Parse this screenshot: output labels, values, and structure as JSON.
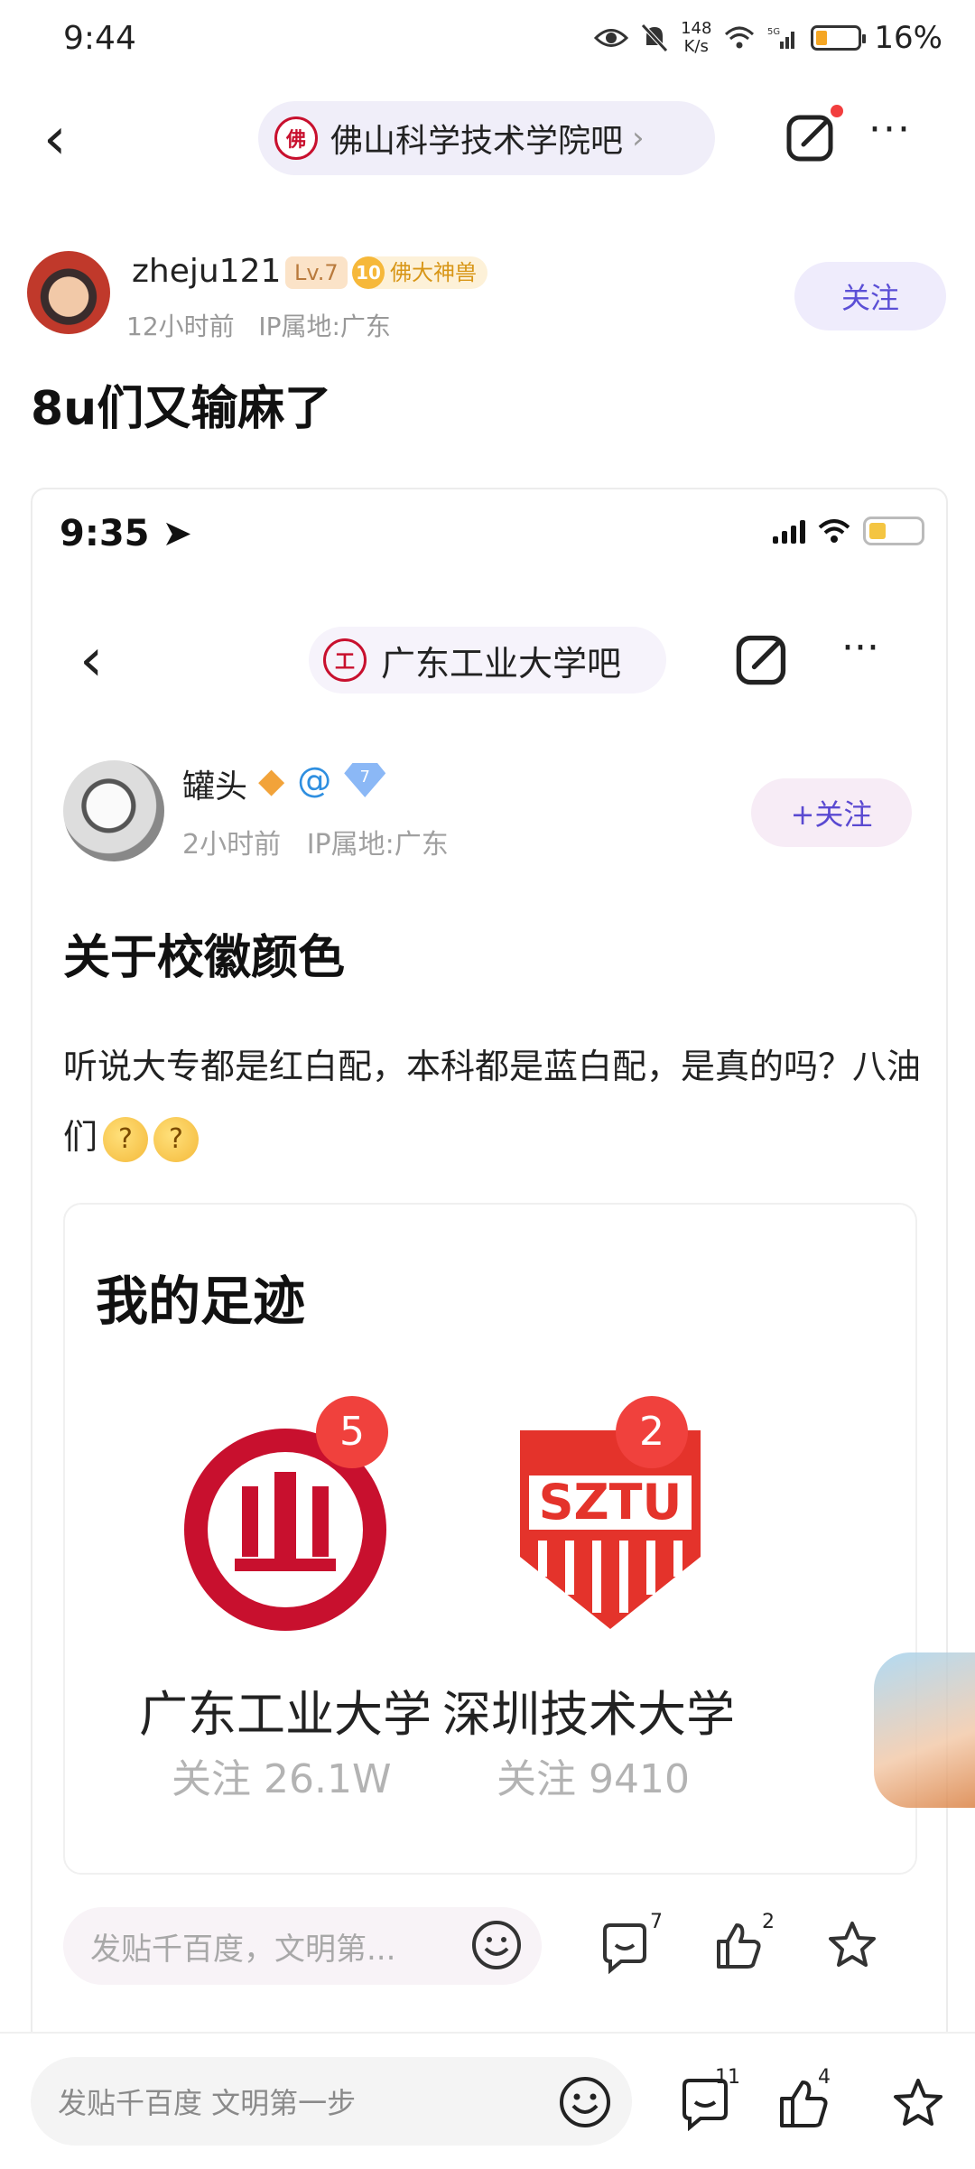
{
  "status": {
    "time": "9:44",
    "speed_top": "148",
    "speed_bottom": "K/s",
    "battery": "16%",
    "network": "5G"
  },
  "nav": {
    "forum_name": "佛山科学技术学院吧",
    "forum_logo_text": "佛"
  },
  "post": {
    "author": "zheju121",
    "level": "Lv.7",
    "title_badge_num": "10",
    "title_badge": "佛大神兽",
    "time": "12小时前",
    "ip": "IP属地:广东",
    "follow": "关注",
    "title": "8u们又输麻了"
  },
  "screenshot": {
    "time": "9:35",
    "forum_name": "广东工业大学吧",
    "forum_logo_text": "工",
    "author": "罐头",
    "level": "7",
    "time_ago": "2小时前",
    "ip": "IP属地:广东",
    "follow": "+关注",
    "title": "关于校徽颜色",
    "body": "听说大专都是红白配，本科都是蓝白配，是真的吗？八油们",
    "footprint": {
      "title": "我的足迹",
      "items": [
        {
          "name": "广东工业大学",
          "follow": "关注 26.1W",
          "badge": "5",
          "logo_text": "工"
        },
        {
          "name": "深圳技术大学",
          "follow": "关注 9410",
          "badge": "2",
          "logo_text": "SZTU"
        }
      ]
    },
    "input_placeholder": "发贴千百度，文明第...",
    "comments": "7",
    "likes": "2"
  },
  "bottom": {
    "placeholder": "发贴千百度 文明第一步",
    "comments": "11",
    "likes": "4"
  }
}
